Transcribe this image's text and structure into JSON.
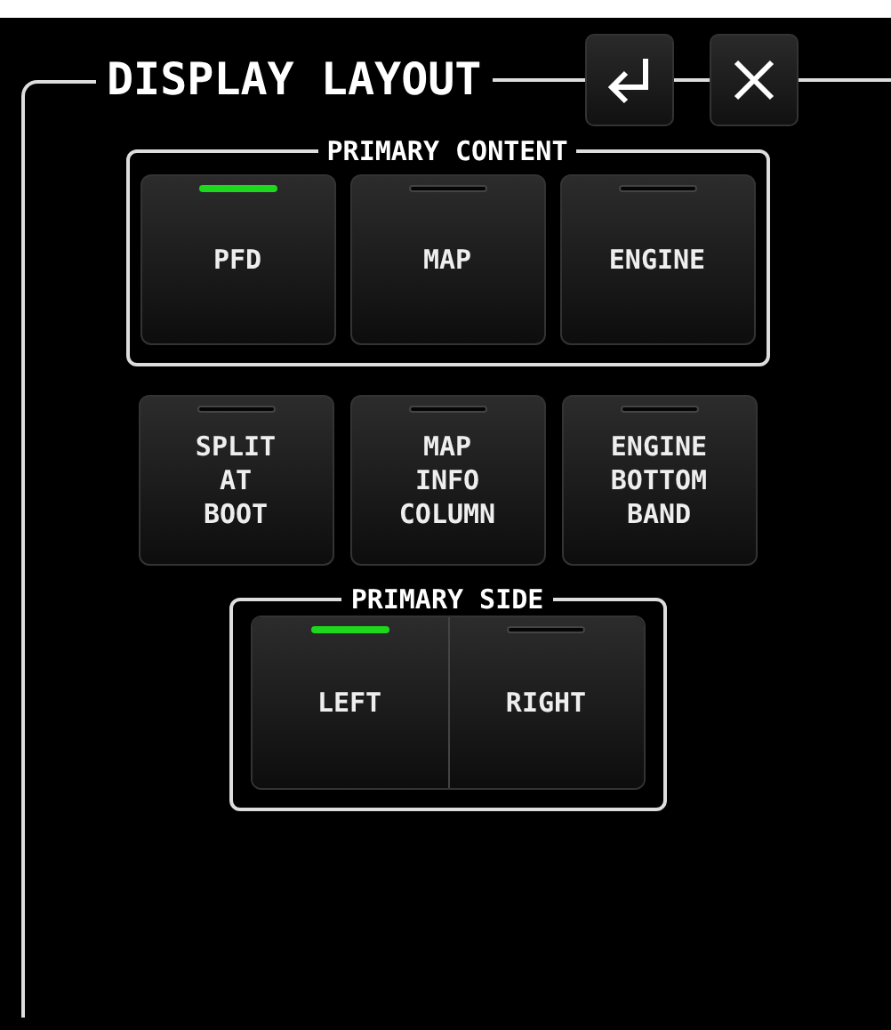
{
  "title": "DISPLAY LAYOUT",
  "header_buttons": [
    {
      "kind": "enter"
    },
    {
      "kind": "close"
    }
  ],
  "primary_content": {
    "label": "PRIMARY CONTENT",
    "options": [
      {
        "label": "PFD",
        "selected": true
      },
      {
        "label": "MAP",
        "selected": false
      },
      {
        "label": "ENGINE",
        "selected": false
      }
    ]
  },
  "toggles": [
    {
      "label": "SPLIT\nAT\nBOOT",
      "on": false
    },
    {
      "label": "MAP\nINFO\nCOLUMN",
      "on": false
    },
    {
      "label": "ENGINE\nBOTTOM\nBAND",
      "on": false
    }
  ],
  "primary_side": {
    "label": "PRIMARY SIDE",
    "options": [
      {
        "label": "LEFT",
        "selected": true
      },
      {
        "label": "RIGHT",
        "selected": false
      }
    ]
  }
}
